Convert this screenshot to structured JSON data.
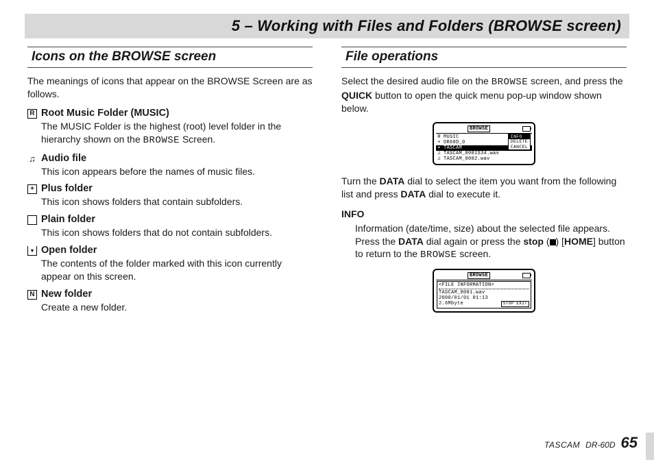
{
  "chapter_title": "5 – Working with Files and Folders (BROWSE screen)",
  "left": {
    "heading": "Icons on the BROWSE screen",
    "intro": "The meanings of icons that appear on the BROWSE Screen are as follows.",
    "items": [
      {
        "icon_name": "root-folder-icon",
        "icon_glyph": "R",
        "term": "Root Music Folder (MUSIC)",
        "desc_pre": "The MUSIC Folder is the highest (root) level folder in the hierarchy shown on the ",
        "desc_lcd": "BROWSE",
        "desc_post": " Screen."
      },
      {
        "icon_name": "audio-file-icon",
        "icon_glyph": "♫",
        "term": "Audio file",
        "desc": "This icon appears before the names of music files."
      },
      {
        "icon_name": "plus-folder-icon",
        "icon_glyph": "+",
        "term": "Plus folder",
        "desc": "This icon shows folders that contain subfolders."
      },
      {
        "icon_name": "plain-folder-icon",
        "icon_glyph": "",
        "term": "Plain folder",
        "desc": "This icon shows folders that do not contain subfolders."
      },
      {
        "icon_name": "open-folder-icon",
        "icon_glyph": "▾",
        "term": "Open folder",
        "desc": "The contents of the folder marked with this icon currently appear on this screen."
      },
      {
        "icon_name": "new-folder-icon",
        "icon_glyph": "N",
        "term": "New folder",
        "desc": "Create a new folder."
      }
    ]
  },
  "right": {
    "heading": "File operations",
    "intro_pre": "Select the desired audio file on the ",
    "intro_lcd": "BROWSE",
    "intro_mid": " screen, and press the ",
    "intro_bold": "QUICK",
    "intro_post": " button to open the quick menu pop-up window shown below.",
    "lcd1": {
      "title": "BROWSE",
      "rows": [
        {
          "icon": "R",
          "label": "MUSIC"
        },
        {
          "icon": "+",
          "label": "DR60D_0"
        },
        {
          "icon": "▾",
          "label": "TASCAM",
          "selected": true
        },
        {
          "icon": "♫",
          "label": "TASCAM_0001S34.wav"
        },
        {
          "icon": "♫",
          "label": "TASCAM_0002.wav"
        }
      ],
      "menu": [
        "INFO",
        "DELETE",
        "CANCEL"
      ],
      "menu_selected": 0
    },
    "turn_pre": "Turn the ",
    "turn_b1": "DATA",
    "turn_mid": " dial to select the item you want from the following list and press ",
    "turn_b2": "DATA",
    "turn_post": " dial to execute it.",
    "info_heading": "INFO",
    "info_line1_pre": "Information (date/time, size) about the selected file appears. Press the ",
    "info_b1": "DATA",
    "info_mid1": " dial again or press the ",
    "info_b2": "stop",
    "info_paren_open": " (",
    "info_paren_close": ") [",
    "info_b3": "HOME",
    "info_mid2": "] button to return to the ",
    "info_lcd": "BROWSE",
    "info_post": " screen.",
    "lcd2": {
      "title": "BROWSE",
      "header2": "<FILE INFORMATION>",
      "line1": "TASCAM_0001.wav",
      "line2": "2000/01/01 01:13",
      "line3": "2.6Mbyte",
      "btn": "STOP EXIT"
    }
  },
  "footer": {
    "brand": "TASCAM",
    "model": "DR-60D",
    "page": "65"
  }
}
